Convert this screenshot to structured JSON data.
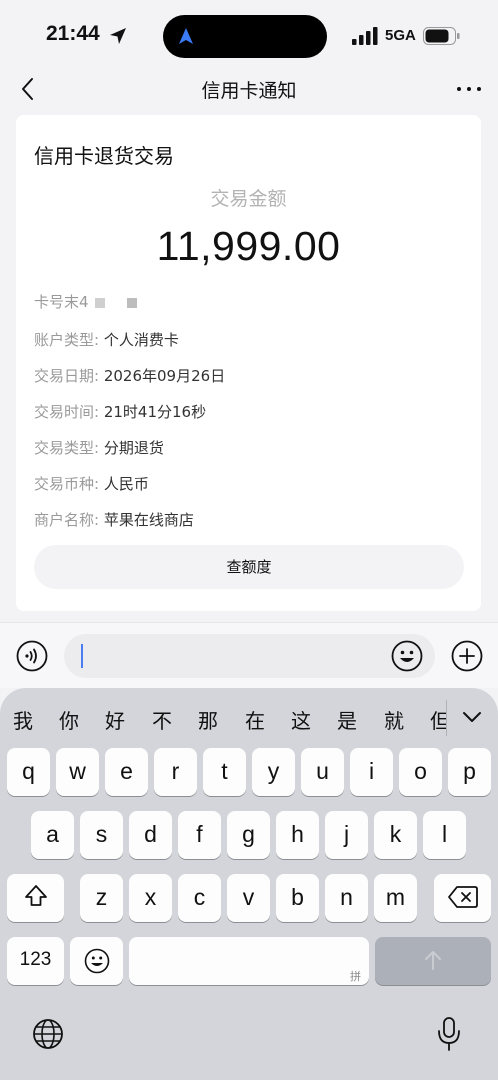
{
  "status_bar": {
    "time": "21:44",
    "network": "5GA"
  },
  "nav": {
    "title": "信用卡通知"
  },
  "card": {
    "title": "信用卡退货交易",
    "amount_label": "交易金额",
    "amount": "11,999.00",
    "card_number_label": "卡号末4",
    "rows": [
      {
        "label": "账户类型:",
        "value": "个人消费卡"
      },
      {
        "label": "交易日期:",
        "value": "2026年09月26日"
      },
      {
        "label": "交易时间:",
        "value": "21时41分16秒"
      },
      {
        "label": "交易类型:",
        "value": "分期退货"
      },
      {
        "label": "交易币种:",
        "value": "人民币"
      },
      {
        "label": "商户名称:",
        "value": "苹果在线商店"
      }
    ],
    "button_label": "查额度"
  },
  "keyboard": {
    "candidates": [
      "我",
      "你",
      "好",
      "不",
      "那",
      "在",
      "这",
      "是",
      "就",
      "但"
    ],
    "row1": [
      "q",
      "w",
      "e",
      "r",
      "t",
      "y",
      "u",
      "i",
      "o",
      "p"
    ],
    "row2": [
      "a",
      "s",
      "d",
      "f",
      "g",
      "h",
      "j",
      "k",
      "l"
    ],
    "row3": [
      "z",
      "x",
      "c",
      "v",
      "b",
      "n",
      "m"
    ],
    "numbers_key": "123",
    "space_hint": "拼"
  },
  "colors": {
    "accent": "#4a7cf3",
    "keyboard_bg": "#d3d5da"
  }
}
